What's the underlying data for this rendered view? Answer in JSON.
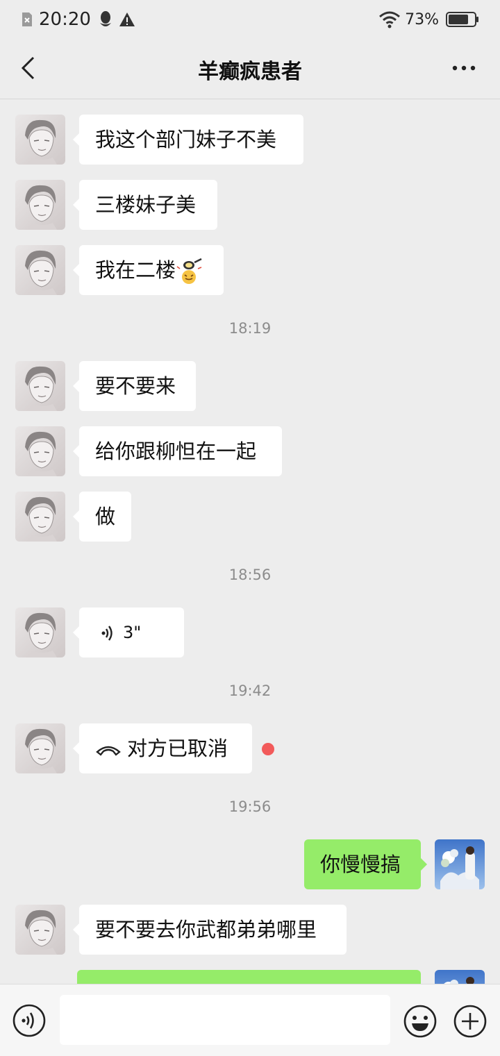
{
  "status_bar": {
    "time": "20:20",
    "battery": "73%"
  },
  "header": {
    "title": "羊癫疯患者"
  },
  "messages": [
    {
      "text": "我这个部门妹子不美"
    },
    {
      "text": "三楼妹子美"
    },
    {
      "text": "我在二楼"
    },
    {
      "time": "18:19"
    },
    {
      "text": "要不要来"
    },
    {
      "text": "给你跟柳怛在一起"
    },
    {
      "text": "做"
    },
    {
      "time": "18:56"
    },
    {
      "text": "3\""
    },
    {
      "time": "19:42"
    },
    {
      "text": "对方已取消"
    },
    {
      "time": "19:56"
    },
    {
      "text": "你慢慢搞"
    },
    {
      "text": "要不要去你武都弟弟哪里"
    }
  ],
  "colors": {
    "outgoing_bubble": "#95ec69",
    "incoming_bubble": "#ffffff",
    "background": "#ededed",
    "unread_dot": "#f25a5a"
  },
  "icons": [
    "back-arrow-icon",
    "more-icon",
    "voice-icon",
    "phone-icon",
    "emoji-icon",
    "plus-icon",
    "wifi-icon",
    "battery-icon",
    "qq-icon",
    "warning-icon"
  ]
}
